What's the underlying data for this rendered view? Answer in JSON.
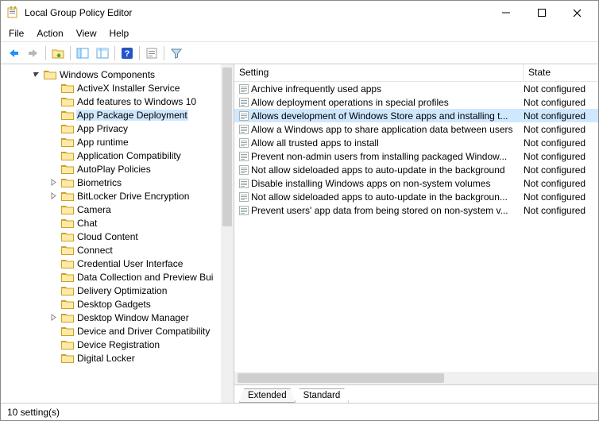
{
  "window": {
    "title": "Local Group Policy Editor"
  },
  "menu": {
    "file": "File",
    "action": "Action",
    "view": "View",
    "help": "Help"
  },
  "tree": {
    "root_label": "Windows Components",
    "root_expanded": true,
    "items": [
      {
        "label": "ActiveX Installer Service"
      },
      {
        "label": "Add features to Windows 10"
      },
      {
        "label": "App Package Deployment",
        "selected": true
      },
      {
        "label": "App Privacy"
      },
      {
        "label": "App runtime"
      },
      {
        "label": "Application Compatibility"
      },
      {
        "label": "AutoPlay Policies"
      },
      {
        "label": "Biometrics",
        "expandable": true
      },
      {
        "label": "BitLocker Drive Encryption",
        "expandable": true
      },
      {
        "label": "Camera"
      },
      {
        "label": "Chat"
      },
      {
        "label": "Cloud Content"
      },
      {
        "label": "Connect"
      },
      {
        "label": "Credential User Interface"
      },
      {
        "label": "Data Collection and Preview Bui"
      },
      {
        "label": "Delivery Optimization"
      },
      {
        "label": "Desktop Gadgets"
      },
      {
        "label": "Desktop Window Manager",
        "expandable": true
      },
      {
        "label": "Device and Driver Compatibility"
      },
      {
        "label": "Device Registration"
      },
      {
        "label": "Digital Locker"
      }
    ]
  },
  "list": {
    "col_setting": "Setting",
    "col_state": "State",
    "rows": [
      {
        "setting": "Archive infrequently used apps",
        "state": "Not configured"
      },
      {
        "setting": "Allow deployment operations in special profiles",
        "state": "Not configured"
      },
      {
        "setting": "Allows development of Windows Store apps and installing t...",
        "state": "Not configured",
        "selected": true
      },
      {
        "setting": "Allow a Windows app to share application data between users",
        "state": "Not configured"
      },
      {
        "setting": "Allow all trusted apps to install",
        "state": "Not configured"
      },
      {
        "setting": "Prevent non-admin users from installing packaged Window...",
        "state": "Not configured"
      },
      {
        "setting": "Not allow sideloaded apps to auto-update in the background",
        "state": "Not configured"
      },
      {
        "setting": "Disable installing Windows apps on non-system volumes",
        "state": "Not configured"
      },
      {
        "setting": "Not allow sideloaded apps to auto-update in the backgroun...",
        "state": "Not configured"
      },
      {
        "setting": "Prevent users' app data from being stored on non-system v...",
        "state": "Not configured"
      }
    ]
  },
  "tabs": {
    "extended": "Extended",
    "standard": "Standard"
  },
  "statusbar": {
    "text": "10 setting(s)"
  }
}
